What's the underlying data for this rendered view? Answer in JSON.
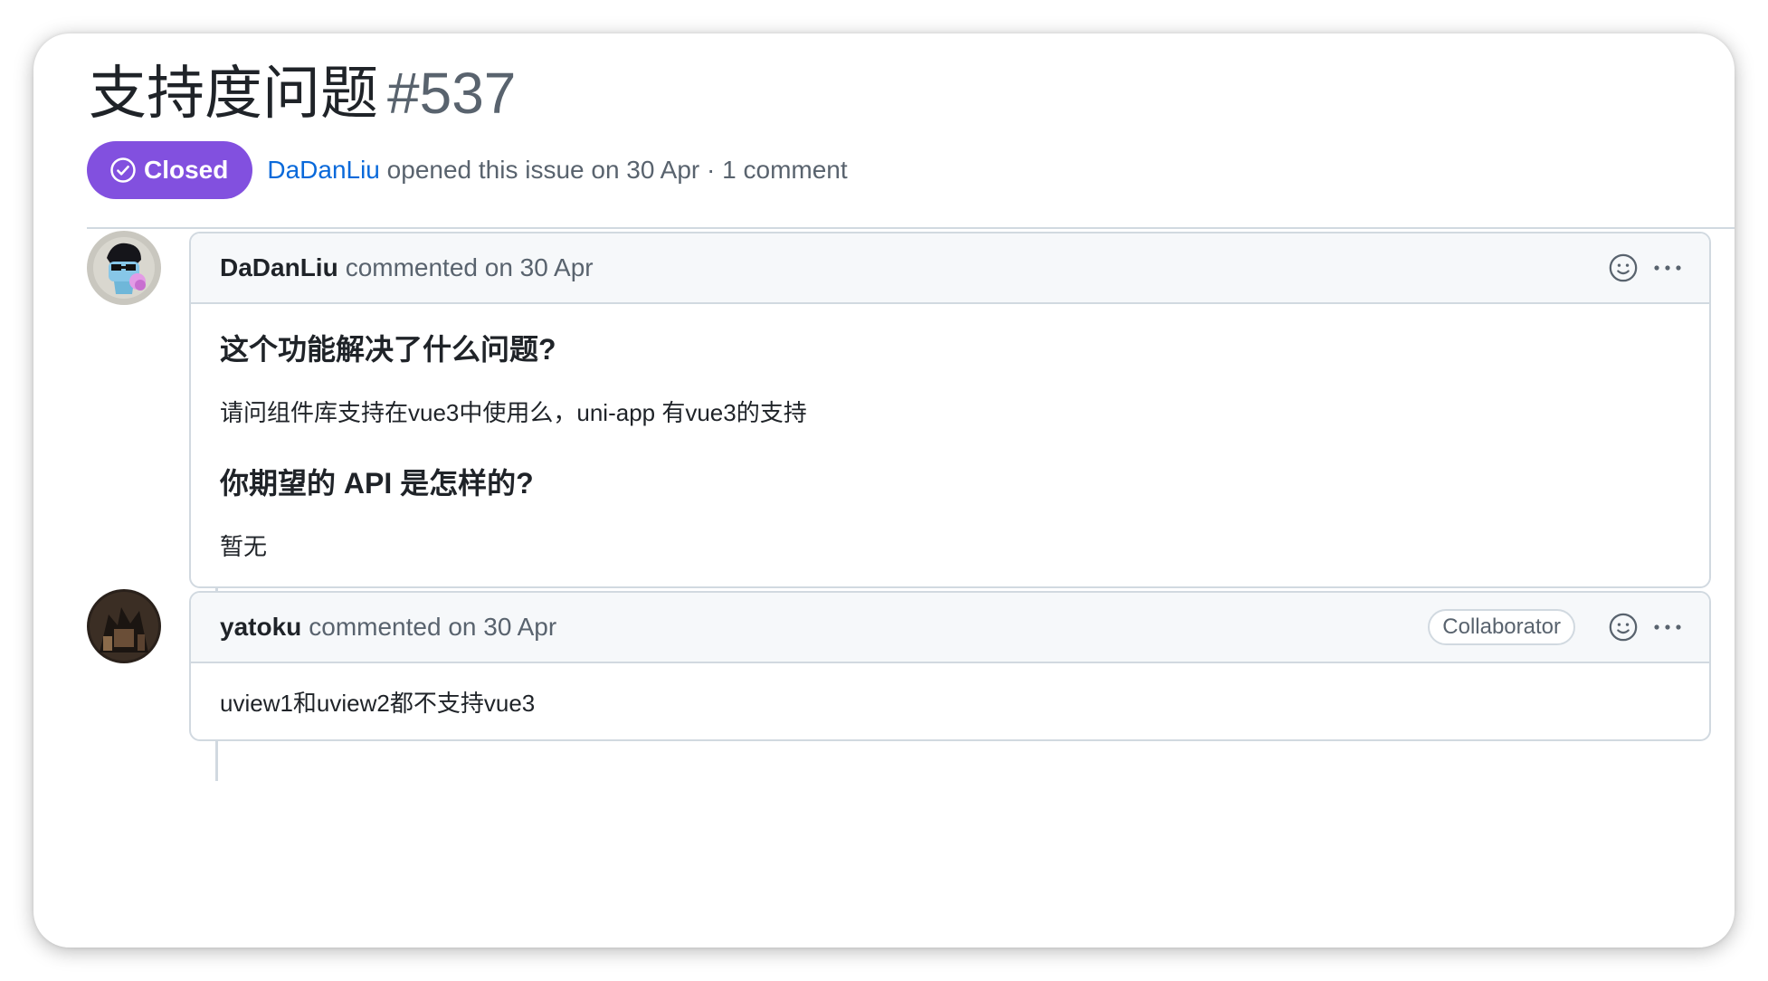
{
  "issue": {
    "title": "支持度问题",
    "number": "#537",
    "status": "Closed",
    "status_color": "#8250df",
    "author": "DaDanLiu",
    "meta_text": "opened this issue on 30 Apr · 1 comment"
  },
  "comments": [
    {
      "author": "DaDanLiu",
      "meta": "commented on 30 Apr",
      "role": "",
      "body": [
        {
          "type": "heading",
          "text": "这个功能解决了什么问题?"
        },
        {
          "type": "paragraph",
          "text": "请问组件库支持在vue3中使用么，uni-app 有vue3的支持"
        },
        {
          "type": "heading",
          "text": "你期望的 API 是怎样的?"
        },
        {
          "type": "paragraph",
          "text": "暂无"
        }
      ]
    },
    {
      "author": "yatoku",
      "meta": "commented on 30 Apr",
      "role": "Collaborator",
      "body": [
        {
          "type": "paragraph",
          "text": "uview1和uview2都不支持vue3"
        }
      ]
    }
  ],
  "icons": {
    "status": "check-circle-icon",
    "reaction": "smiley-icon",
    "more": "kebab-horizontal-icon"
  }
}
